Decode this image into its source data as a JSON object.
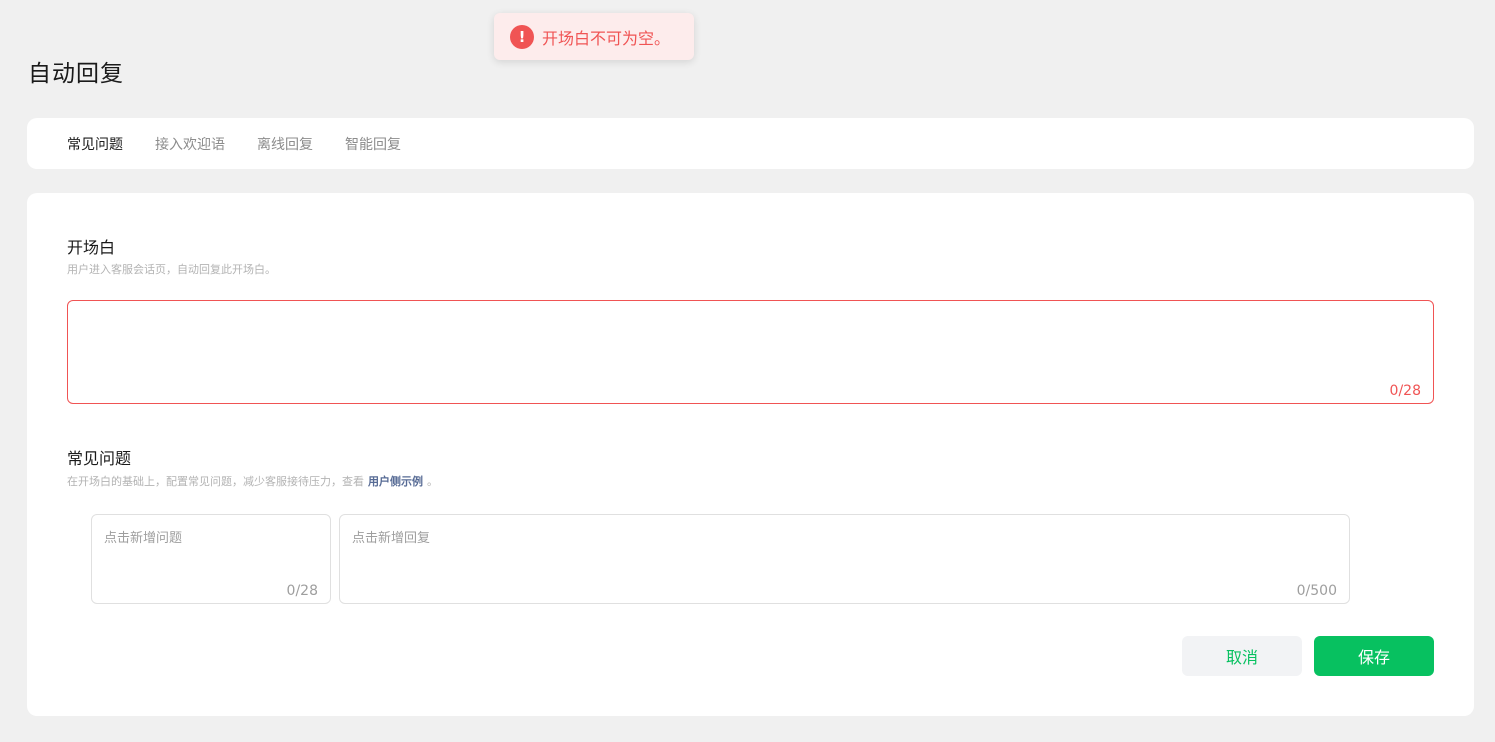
{
  "toast": {
    "message": "开场白不可为空。",
    "icon": "alert-circle-icon",
    "color": "#f05454"
  },
  "page": {
    "title": "自动回复"
  },
  "tabs": [
    {
      "label": "常见问题",
      "active": true
    },
    {
      "label": "接入欢迎语",
      "active": false
    },
    {
      "label": "离线回复",
      "active": false
    },
    {
      "label": "智能回复",
      "active": false
    }
  ],
  "opening": {
    "title": "开场白",
    "description": "用户进入客服会话页，自动回复此开场白。",
    "value": "",
    "count": "0/28"
  },
  "faq": {
    "title": "常见问题",
    "description_prefix": "在开场白的基础上，配置常见问题，减少客服接待压力，查看",
    "link": "用户侧示例",
    "description_suffix": "。",
    "question_placeholder": "点击新增问题",
    "question_count": "0/28",
    "answer_placeholder": "点击新增回复",
    "answer_count": "0/500"
  },
  "actions": {
    "cancel": "取消",
    "save": "保存"
  },
  "colors": {
    "accent": "#07c160",
    "error": "#f05454",
    "link": "#576b95"
  }
}
